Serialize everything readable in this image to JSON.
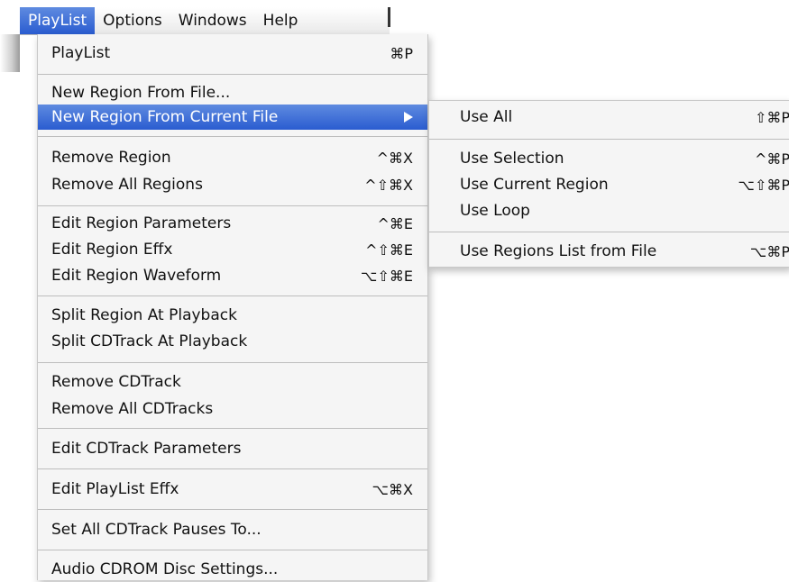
{
  "menubar": {
    "items": [
      "PlayList",
      "Options",
      "Windows",
      "Help"
    ]
  },
  "playlist_menu": {
    "playlist": {
      "label": "PlayList",
      "shortcut": "⌘P"
    },
    "new_region_from_file": {
      "label": "New Region From File..."
    },
    "new_region_from_current_file": {
      "label": "New Region From Current File"
    },
    "remove_region": {
      "label": "Remove Region",
      "shortcut": "^⌘X"
    },
    "remove_all_regions": {
      "label": "Remove All Regions",
      "shortcut": "^⇧⌘X"
    },
    "edit_region_parameters": {
      "label": "Edit Region Parameters",
      "shortcut": "^⌘E"
    },
    "edit_region_effx": {
      "label": "Edit Region Effx",
      "shortcut": "^⇧⌘E"
    },
    "edit_region_waveform": {
      "label": "Edit Region Waveform",
      "shortcut": "⌥⇧⌘E"
    },
    "split_region_at_playback": {
      "label": "Split Region At Playback"
    },
    "split_cdtrack_at_playback": {
      "label": "Split CDTrack At Playback"
    },
    "remove_cdtrack": {
      "label": "Remove CDTrack"
    },
    "remove_all_cdtracks": {
      "label": "Remove All CDTracks"
    },
    "edit_cdtrack_parameters": {
      "label": "Edit CDTrack Parameters"
    },
    "edit_playlist_effx": {
      "label": "Edit PlayList Effx",
      "shortcut": "⌥⌘X"
    },
    "set_all_cdtrack_pauses": {
      "label": "Set All CDTrack Pauses To..."
    },
    "audio_cdrom_disc_settings": {
      "label": "Audio CDROM Disc Settings..."
    }
  },
  "submenu": {
    "use_all": {
      "label": "Use All",
      "shortcut": "⇧⌘P"
    },
    "use_selection": {
      "label": "Use Selection",
      "shortcut": "^⌘P"
    },
    "use_current_region": {
      "label": "Use Current Region",
      "shortcut": "⌥⇧⌘P"
    },
    "use_loop": {
      "label": "Use Loop"
    },
    "use_regions_list_from_file": {
      "label": "Use Regions List from File",
      "shortcut": "⌥⌘P"
    }
  },
  "colors": {
    "highlight": "#3a6cd8",
    "menu_bg": "#f5f5f5"
  }
}
